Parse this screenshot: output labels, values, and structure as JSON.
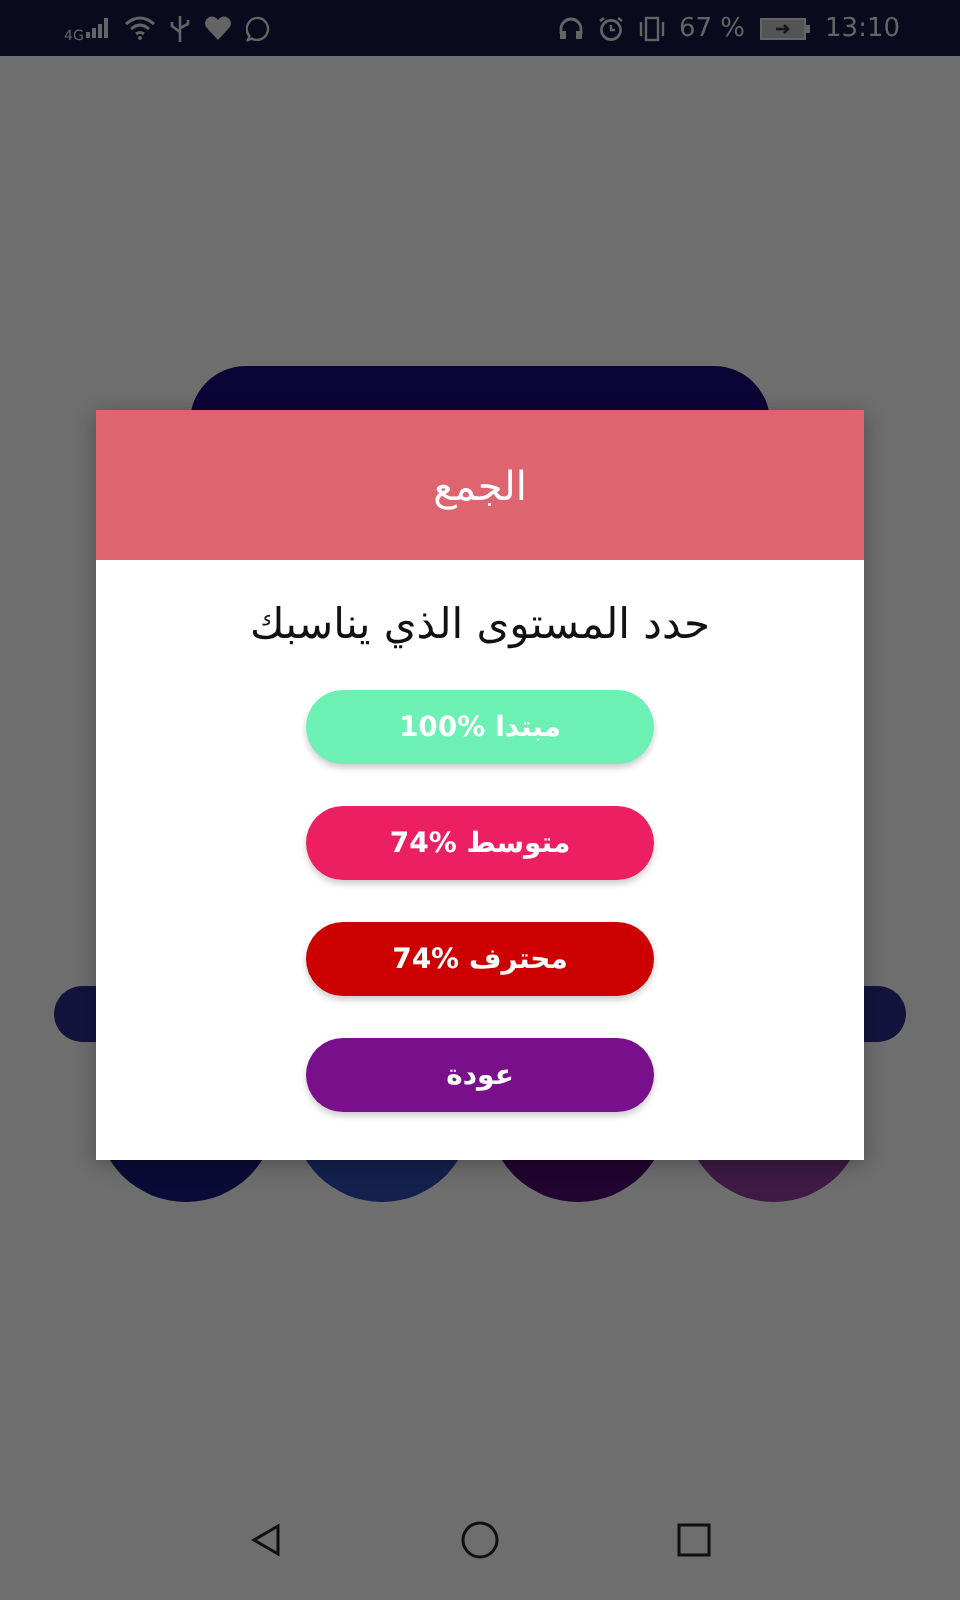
{
  "status_bar": {
    "network": "4G",
    "battery_percent": "67 %",
    "time": "13:10"
  },
  "dialog": {
    "title": "الجمع",
    "prompt": "حدد المستوى الذي يناسبك",
    "buttons": [
      {
        "label": "100% مبتدا",
        "color": "#6cf0b4"
      },
      {
        "label": "74% متوسط",
        "color": "#ec1f63"
      },
      {
        "label": "74% محترف",
        "color": "#cc0000"
      },
      {
        "label": "عودة",
        "color": "#7a0f8c"
      }
    ]
  }
}
